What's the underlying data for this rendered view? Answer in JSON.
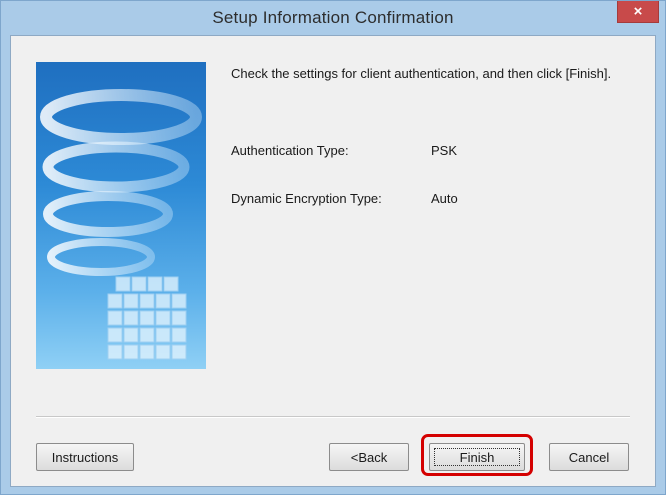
{
  "window": {
    "title": "Setup Information Confirmation",
    "close_label": "×",
    "accent_color": "#aacbe8"
  },
  "content": {
    "message": "Check the settings for client authentication, and then click [Finish].",
    "rows": [
      {
        "label": "Authentication Type:",
        "value": "PSK"
      },
      {
        "label": "Dynamic Encryption Type:",
        "value": "Auto"
      }
    ]
  },
  "buttons": {
    "instructions": "Instructions",
    "back": "<Back",
    "finish": "Finish",
    "cancel": "Cancel"
  },
  "highlight_color": "#d40000"
}
